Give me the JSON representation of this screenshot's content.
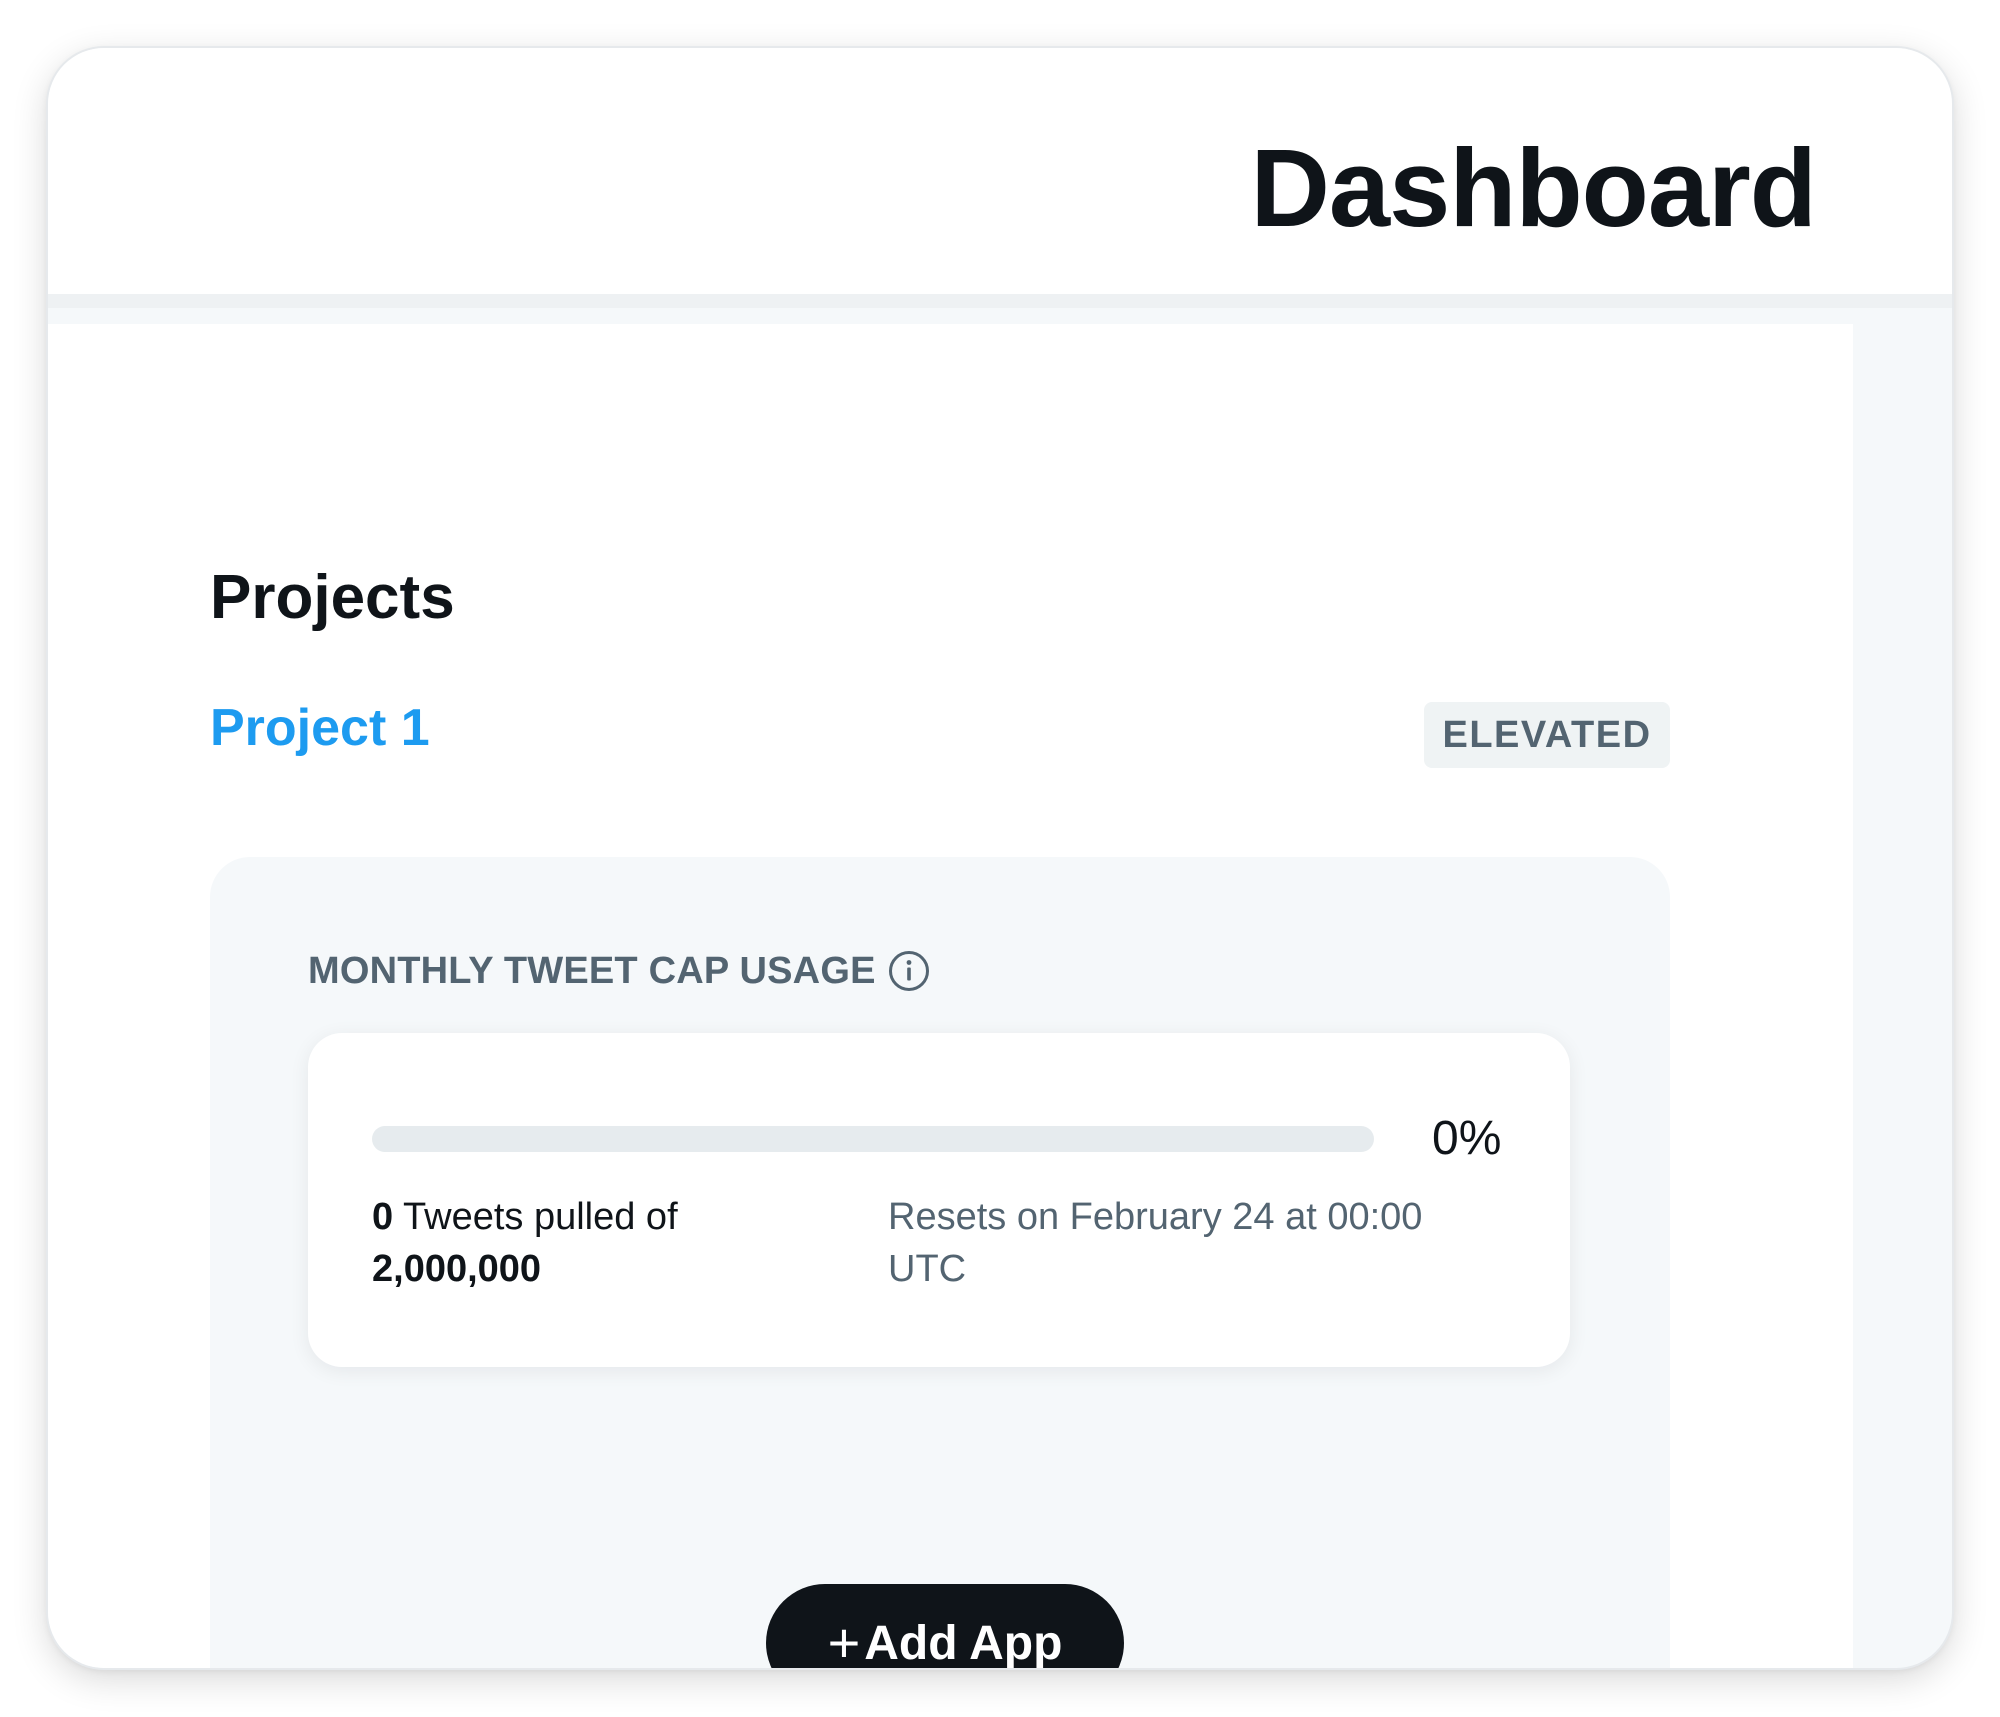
{
  "header": {
    "title": "Dashboard"
  },
  "projects": {
    "heading": "Projects",
    "project_name": "Project 1",
    "access_level": "ELEVATED"
  },
  "usage": {
    "title": "MONTHLY TWEET CAP USAGE",
    "info_icon": "info-circle-icon",
    "percent_text": "0%",
    "progress_fraction": 0,
    "pulled_count": "0",
    "pulled_middle": "Tweets pulled of",
    "pulled_cap": "2,000,000",
    "reset_text": "Resets on February 24 at 00:00 UTC"
  },
  "actions": {
    "add_app_icon": "plus-icon",
    "add_app_symbol": "+",
    "add_app_label": "Add App"
  },
  "colors": {
    "accent": "#1d9bf0",
    "text_primary": "#0f1419",
    "text_secondary": "#536471",
    "button_bg": "#0f1419"
  }
}
